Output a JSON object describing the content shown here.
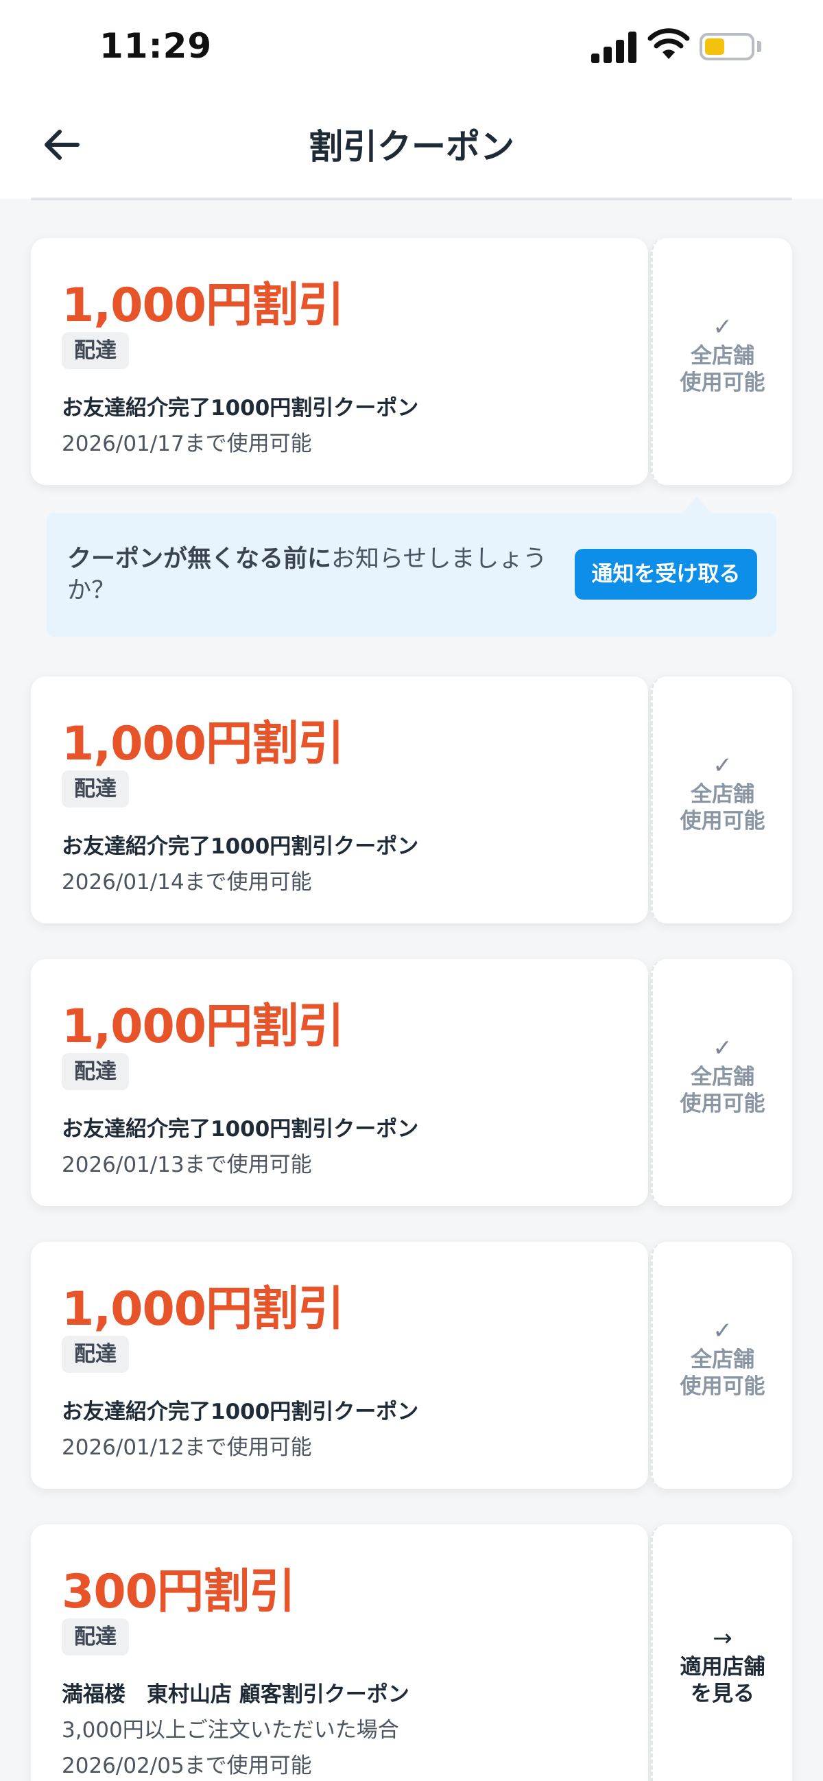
{
  "status_bar": {
    "time": "11:29"
  },
  "header": {
    "title": "割引クーポン"
  },
  "notify": {
    "bold_text": "クーポンが無くなる前に",
    "text": "お知らせしましょうか？",
    "button_label": "通知を受け取る"
  },
  "coupons": [
    {
      "amount": "1,000円割引",
      "tag": "配達",
      "name": "お友達紹介完了1000円割引クーポン",
      "expiry": "2026/01/17まで使用可能",
      "side_line1": "全店舗",
      "side_line2": "使用可能",
      "side_icon": "✓"
    },
    {
      "amount": "1,000円割引",
      "tag": "配達",
      "name": "お友達紹介完了1000円割引クーポン",
      "expiry": "2026/01/14まで使用可能",
      "side_line1": "全店舗",
      "side_line2": "使用可能",
      "side_icon": "✓"
    },
    {
      "amount": "1,000円割引",
      "tag": "配達",
      "name": "お友達紹介完了1000円割引クーポン",
      "expiry": "2026/01/13まで使用可能",
      "side_line1": "全店舗",
      "side_line2": "使用可能",
      "side_icon": "✓"
    },
    {
      "amount": "1,000円割引",
      "tag": "配達",
      "name": "お友達紹介完了1000円割引クーポン",
      "expiry": "2026/01/12まで使用可能",
      "side_line1": "全店舗",
      "side_line2": "使用可能",
      "side_icon": "✓"
    },
    {
      "amount": "300円割引",
      "tag": "配達",
      "name": "満福楼　東村山店 顧客割引クーポン",
      "condition": "3,000円以上ご注文いただいた場合",
      "expiry": "2026/02/05まで使用可能",
      "side_line1": "適用店舗",
      "side_line2": "を見る",
      "side_icon": "→"
    }
  ],
  "icons": {
    "back": "arrow-left-icon",
    "check": "check-icon",
    "arrow_right": "arrow-right-icon",
    "signal": "signal-icon",
    "wifi": "wifi-icon",
    "battery": "battery-icon"
  },
  "colors": {
    "accent": "#e8542a",
    "button": "#0d8ee8",
    "banner": "#e7f4fd",
    "battery": "#f4c20d"
  }
}
